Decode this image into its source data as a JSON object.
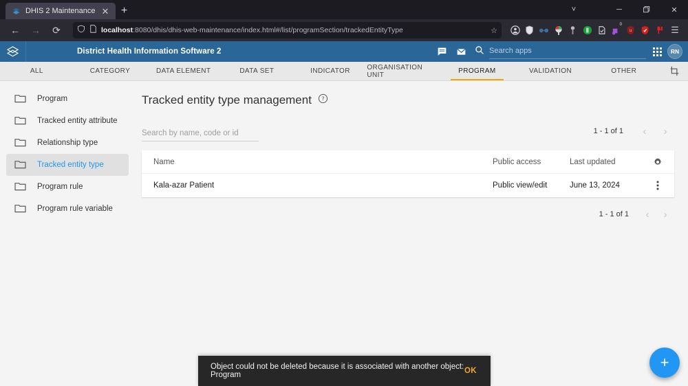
{
  "browser": {
    "tab": {
      "title": "DHIS 2 Maintenance",
      "favicon_name": "dhis2-logo-icon",
      "close_label": "✕"
    },
    "new_tab_label": "+",
    "window_controls": {
      "list_all_tabs": "˅",
      "minimize": "─",
      "maximize": "❐",
      "close": "✕"
    },
    "nav": {
      "back": "←",
      "forward": "→",
      "reload": "⟳"
    },
    "url": {
      "protocol_host": "localhost",
      "rest": ":8080/dhis/dhis-web-maintenance/index.html#/list/programSection/trackedEntityType",
      "bookmark_star": "☆"
    },
    "extensions": [
      {
        "name": "account-icon",
        "glyph": "◉",
        "color": "#d8d8e0"
      },
      {
        "name": "shield-extension-icon",
        "glyph": "■",
        "color": "#dcdce4"
      },
      {
        "name": "glasses-extension-icon",
        "glyph": "●",
        "color": "#4a7fb5"
      },
      {
        "name": "color-picker-extension-icon",
        "glyph": "●",
        "color": "#e8e8e8"
      },
      {
        "name": "key-extension-icon",
        "glyph": "●",
        "color": "#9a9aa4"
      },
      {
        "name": "bitwarden-extension-icon",
        "glyph": "●",
        "color": "#27a844"
      },
      {
        "name": "pocket-extension-icon",
        "glyph": "●",
        "color": "#d0d0d8"
      },
      {
        "name": "purple-extension-icon",
        "glyph": "●",
        "color": "#a050d8",
        "badge": "0"
      },
      {
        "name": "ublock-extension-icon",
        "glyph": "●",
        "color": "#8b1a1a"
      },
      {
        "name": "red-shield-extension-icon",
        "glyph": "●",
        "color": "#d41b1b"
      },
      {
        "name": "dislike-extension-icon",
        "glyph": "●",
        "color": "#e02020"
      }
    ],
    "menu_glyph": "☰"
  },
  "header": {
    "logo_name": "dhis2-layers-logo",
    "title": "District Health Information Software 2",
    "message_icon": "message-icon",
    "mail_icon": "mail-icon",
    "search": {
      "placeholder": "Search apps",
      "value": "",
      "icon": "search-icon"
    },
    "apps_icon": "apps-grid-icon",
    "avatar_initials": "RN"
  },
  "section_tabs": [
    {
      "label": "ALL",
      "active": false
    },
    {
      "label": "CATEGORY",
      "active": false
    },
    {
      "label": "DATA ELEMENT",
      "active": false
    },
    {
      "label": "DATA SET",
      "active": false
    },
    {
      "label": "INDICATOR",
      "active": false
    },
    {
      "label": "ORGANISATION UNIT",
      "active": false
    },
    {
      "label": "PROGRAM",
      "active": true
    },
    {
      "label": "VALIDATION",
      "active": false
    },
    {
      "label": "OTHER",
      "active": false
    }
  ],
  "section_tabs_action_icon": "crop-customize-icon",
  "sidebar": {
    "items": [
      {
        "label": "Program",
        "active": false
      },
      {
        "label": "Tracked entity attribute",
        "active": false
      },
      {
        "label": "Relationship type",
        "active": false
      },
      {
        "label": "Tracked entity type",
        "active": true
      },
      {
        "label": "Program rule",
        "active": false
      },
      {
        "label": "Program rule variable",
        "active": false
      }
    ]
  },
  "main": {
    "page_title": "Tracked entity type management",
    "help_icon": "help-circle-icon",
    "list_search": {
      "placeholder": "Search by name, code or id",
      "value": ""
    },
    "pagination": {
      "label": "1 - 1 of 1",
      "prev": "‹",
      "next": "›"
    },
    "table": {
      "columns": [
        "Name",
        "Public access",
        "Last updated"
      ],
      "settings_icon": "gear-icon",
      "rows": [
        {
          "name": "Kala-azar Patient",
          "public_access": "Public view/edit",
          "last_updated": "June 13, 2024",
          "actions_icon": "more-vertical-icon"
        }
      ]
    },
    "fab": {
      "label": "+",
      "name": "add-button",
      "color": "#2196f3"
    }
  },
  "snackbar": {
    "message": "Object could not be deleted because it is associated with another object: Program",
    "action_label": "OK",
    "action_color": "#f5a623"
  },
  "colors": {
    "header_blue": "#2b6698",
    "accent_orange": "#f0a30a",
    "link_blue": "#2196f3",
    "page_bg": "#f4f4f4"
  }
}
